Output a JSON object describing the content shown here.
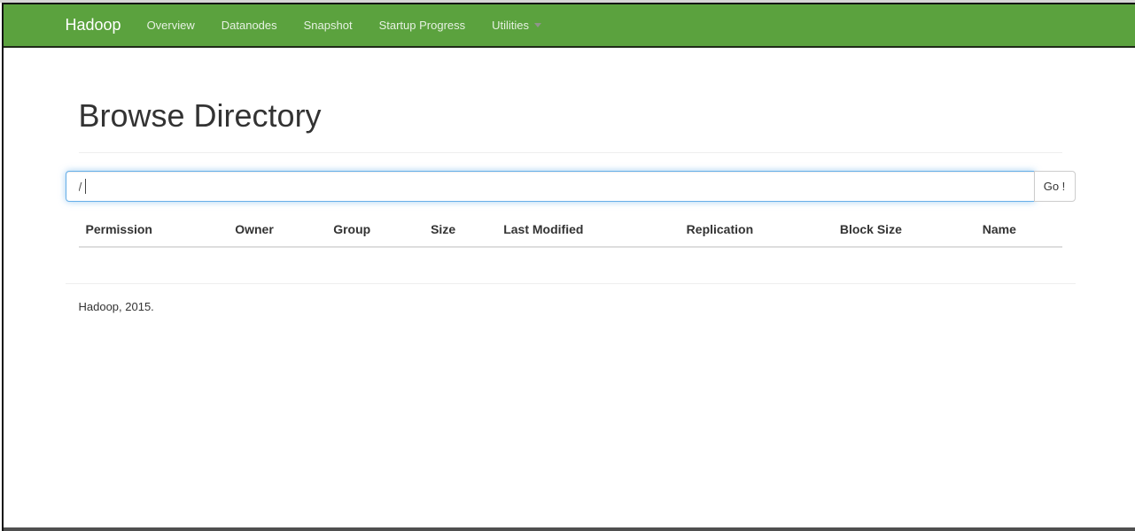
{
  "navbar": {
    "brand": "Hadoop",
    "items": [
      {
        "label": "Overview"
      },
      {
        "label": "Datanodes"
      },
      {
        "label": "Snapshot"
      },
      {
        "label": "Startup Progress"
      },
      {
        "label": "Utilities"
      }
    ],
    "utilities_caret_icon": "caret-down"
  },
  "page": {
    "title": "Browse Directory"
  },
  "directory_form": {
    "path_value": "/",
    "go_button_label": "Go !"
  },
  "file_table": {
    "columns": [
      "Permission",
      "Owner",
      "Group",
      "Size",
      "Last Modified",
      "Replication",
      "Block Size",
      "Name"
    ],
    "rows": []
  },
  "footer": {
    "text": "Hadoop, 2015."
  },
  "colors": {
    "navbar_background": "#5ba23e",
    "navbar_brand_text": "#ffffff",
    "input_focus_border": "#66afe9",
    "table_header_border": "#dddddd",
    "frame_border": "#121212"
  }
}
